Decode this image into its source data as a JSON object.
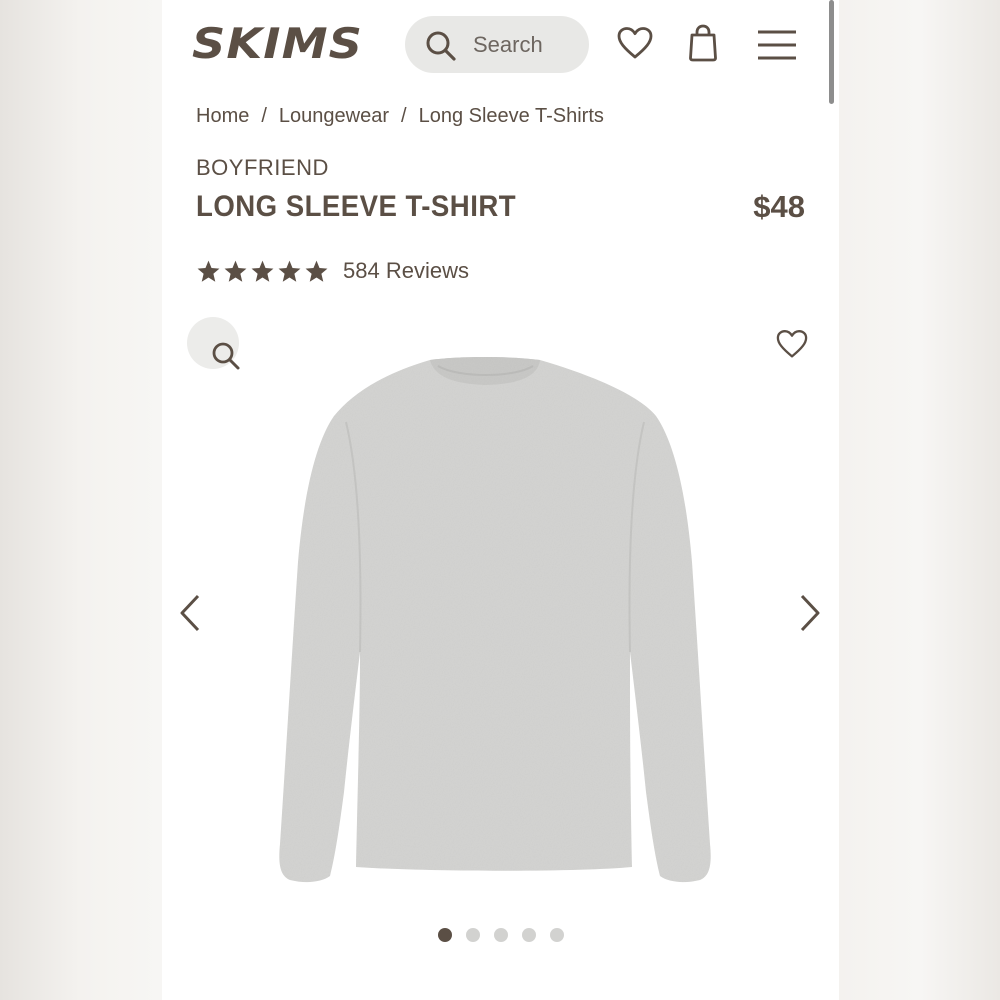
{
  "header": {
    "logo": "SKIMS",
    "search_placeholder": "Search",
    "icons": [
      "search-icon",
      "heart-icon",
      "shopping-bag-icon",
      "hamburger-menu-icon"
    ]
  },
  "breadcrumb": {
    "items": [
      "Home",
      "Loungewear",
      "Long Sleeve T-Shirts"
    ],
    "separator": "/"
  },
  "product": {
    "brand_line": "BOYFRIEND",
    "title": "LONG SLEEVE T-SHIRT",
    "price": "$48",
    "rating_stars": 5,
    "reviews": "584 Reviews",
    "image_alt_icon": "long-sleeve-tshirt",
    "image_color": "#d4d4d2"
  },
  "gallery": {
    "icons": [
      "zoom-icon",
      "heart-icon",
      "chevron-left-icon",
      "chevron-right-icon"
    ],
    "slide_count": 5,
    "active_slide": 1
  },
  "colors": {
    "brand_text": "#5b4f45",
    "search_bg": "#e8e8e6",
    "dot_inactive": "#d2d2d0"
  }
}
